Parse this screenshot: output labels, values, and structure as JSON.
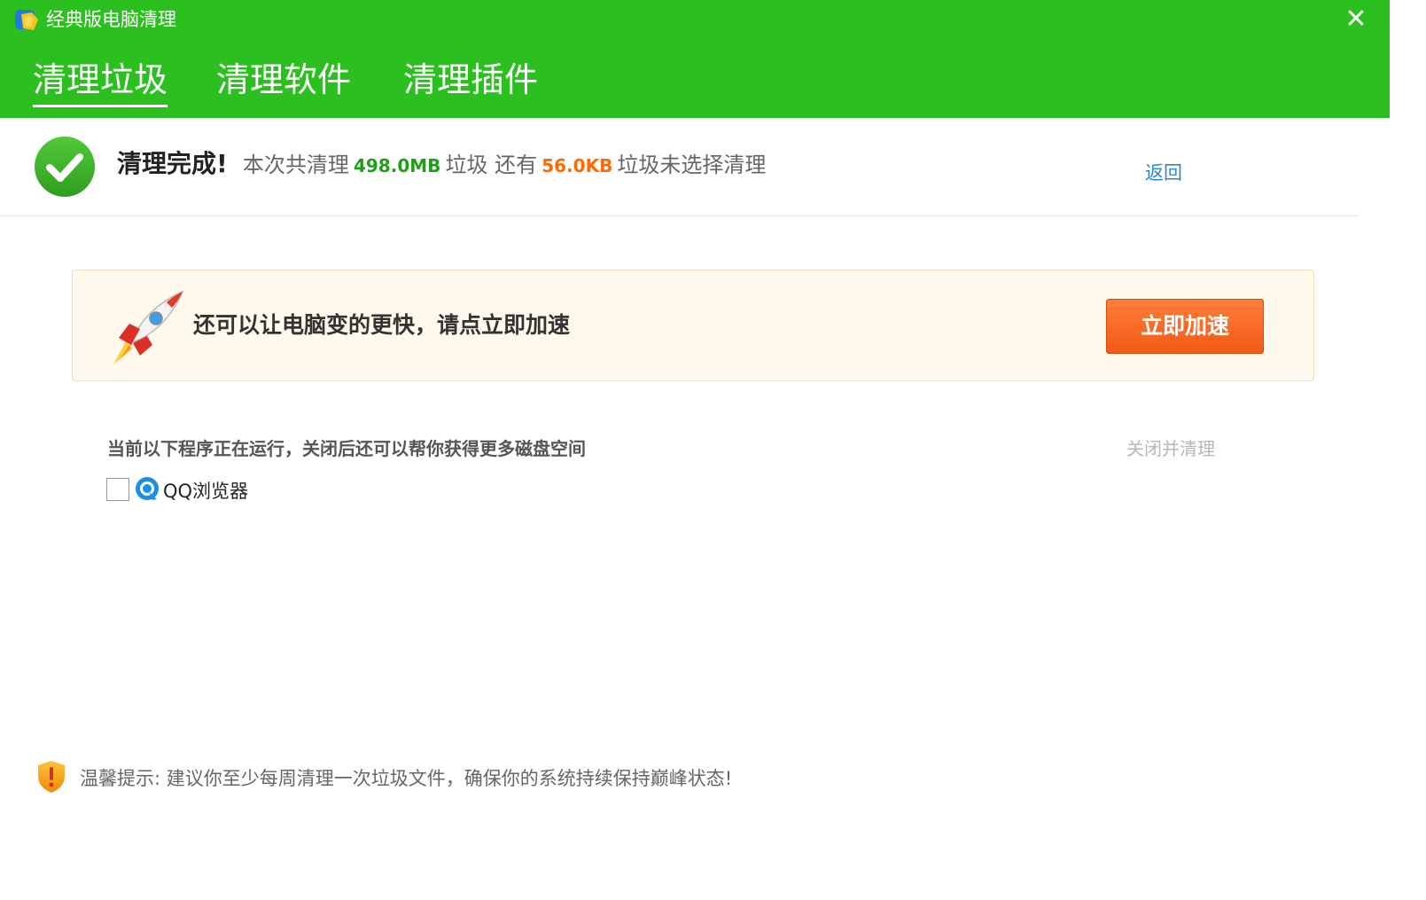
{
  "window": {
    "title": "经典版电脑清理",
    "close_glyph": "✕"
  },
  "tabs": [
    {
      "label": "清理垃圾",
      "active": true
    },
    {
      "label": "清理软件",
      "active": false
    },
    {
      "label": "清理插件",
      "active": false
    }
  ],
  "result": {
    "done_text": "清理完成!",
    "prefix": "本次共清理",
    "cleaned_amount": "498.0MB",
    "middle": "垃圾 还有",
    "remaining_amount": "56.0KB",
    "suffix": "垃圾未选择清理",
    "back_label": "返回"
  },
  "promo": {
    "text": "还可以让电脑变的更快，请点立即加速",
    "button_label": "立即加速"
  },
  "running": {
    "label": "当前以下程序正在运行，关闭后还可以帮你获得更多磁盘空间",
    "close_clean_label": "关闭并清理",
    "programs": [
      {
        "name": "QQ浏览器",
        "checked": false
      }
    ]
  },
  "tip": {
    "text": "温馨提示: 建议你至少每周清理一次垃圾文件，确保你的系统持续保持巅峰状态!"
  },
  "colors": {
    "header": "#2bbf1f",
    "accent_green": "#1f9f17",
    "accent_orange": "#ff6a00",
    "link": "#2b86d8",
    "button": "#f15a14"
  },
  "icons": {
    "app": "broom-app-icon",
    "check": "check-circle-icon",
    "rocket": "rocket-icon",
    "browser": "qq-browser-icon",
    "tip": "warning-shield-icon"
  }
}
